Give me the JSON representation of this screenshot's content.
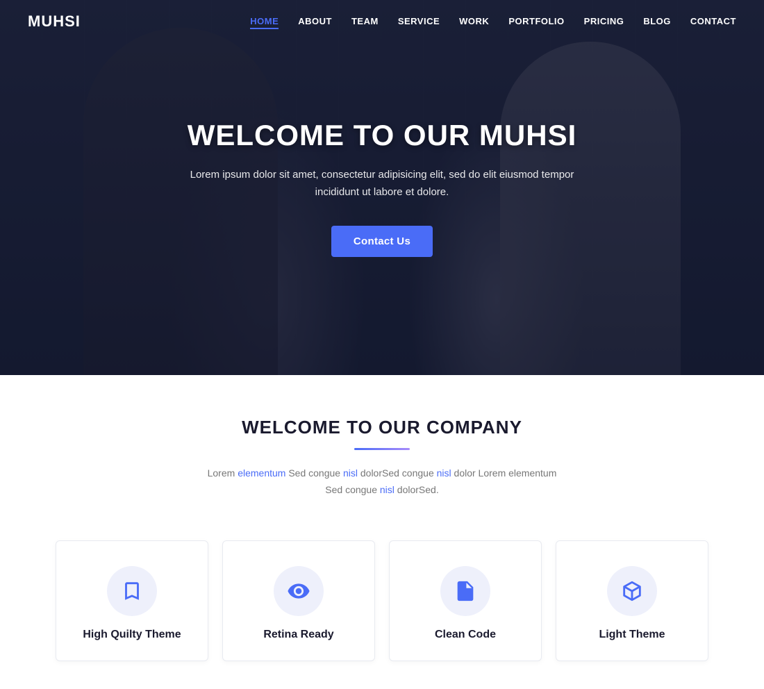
{
  "navbar": {
    "logo": "MUHSI",
    "links": [
      {
        "label": "HOME",
        "active": true
      },
      {
        "label": "ABOUT",
        "active": false
      },
      {
        "label": "TEAM",
        "active": false
      },
      {
        "label": "SERVICE",
        "active": false
      },
      {
        "label": "WORK",
        "active": false
      },
      {
        "label": "PORTFOLIO",
        "active": false
      },
      {
        "label": "PRICING",
        "active": false
      },
      {
        "label": "BLOG",
        "active": false
      },
      {
        "label": "CONTACT",
        "active": false
      }
    ]
  },
  "hero": {
    "title": "WELCOME TO OUR MUHSI",
    "subtitle": "Lorem ipsum dolor sit amet, consectetur adipisicing elit, sed do elit eiusmod tempor incididunt ut labore et dolore.",
    "cta_label": "Contact Us"
  },
  "welcome": {
    "title": "WELCOME TO OUR COMPANY",
    "description": "Lorem elementum Sed congue nisl dolorSed congue nisl dolor Lorem elementum Sed congue nisl dolorSed."
  },
  "features": [
    {
      "name": "High Quilty Theme",
      "icon": "bookmark-icon"
    },
    {
      "name": "Retina Ready",
      "icon": "eye-icon"
    },
    {
      "name": "Clean Code",
      "icon": "code-file-icon"
    },
    {
      "name": "Light Theme",
      "icon": "cube-icon"
    }
  ],
  "colors": {
    "accent": "#4a6cf7",
    "accent_light": "#eef0fb"
  }
}
